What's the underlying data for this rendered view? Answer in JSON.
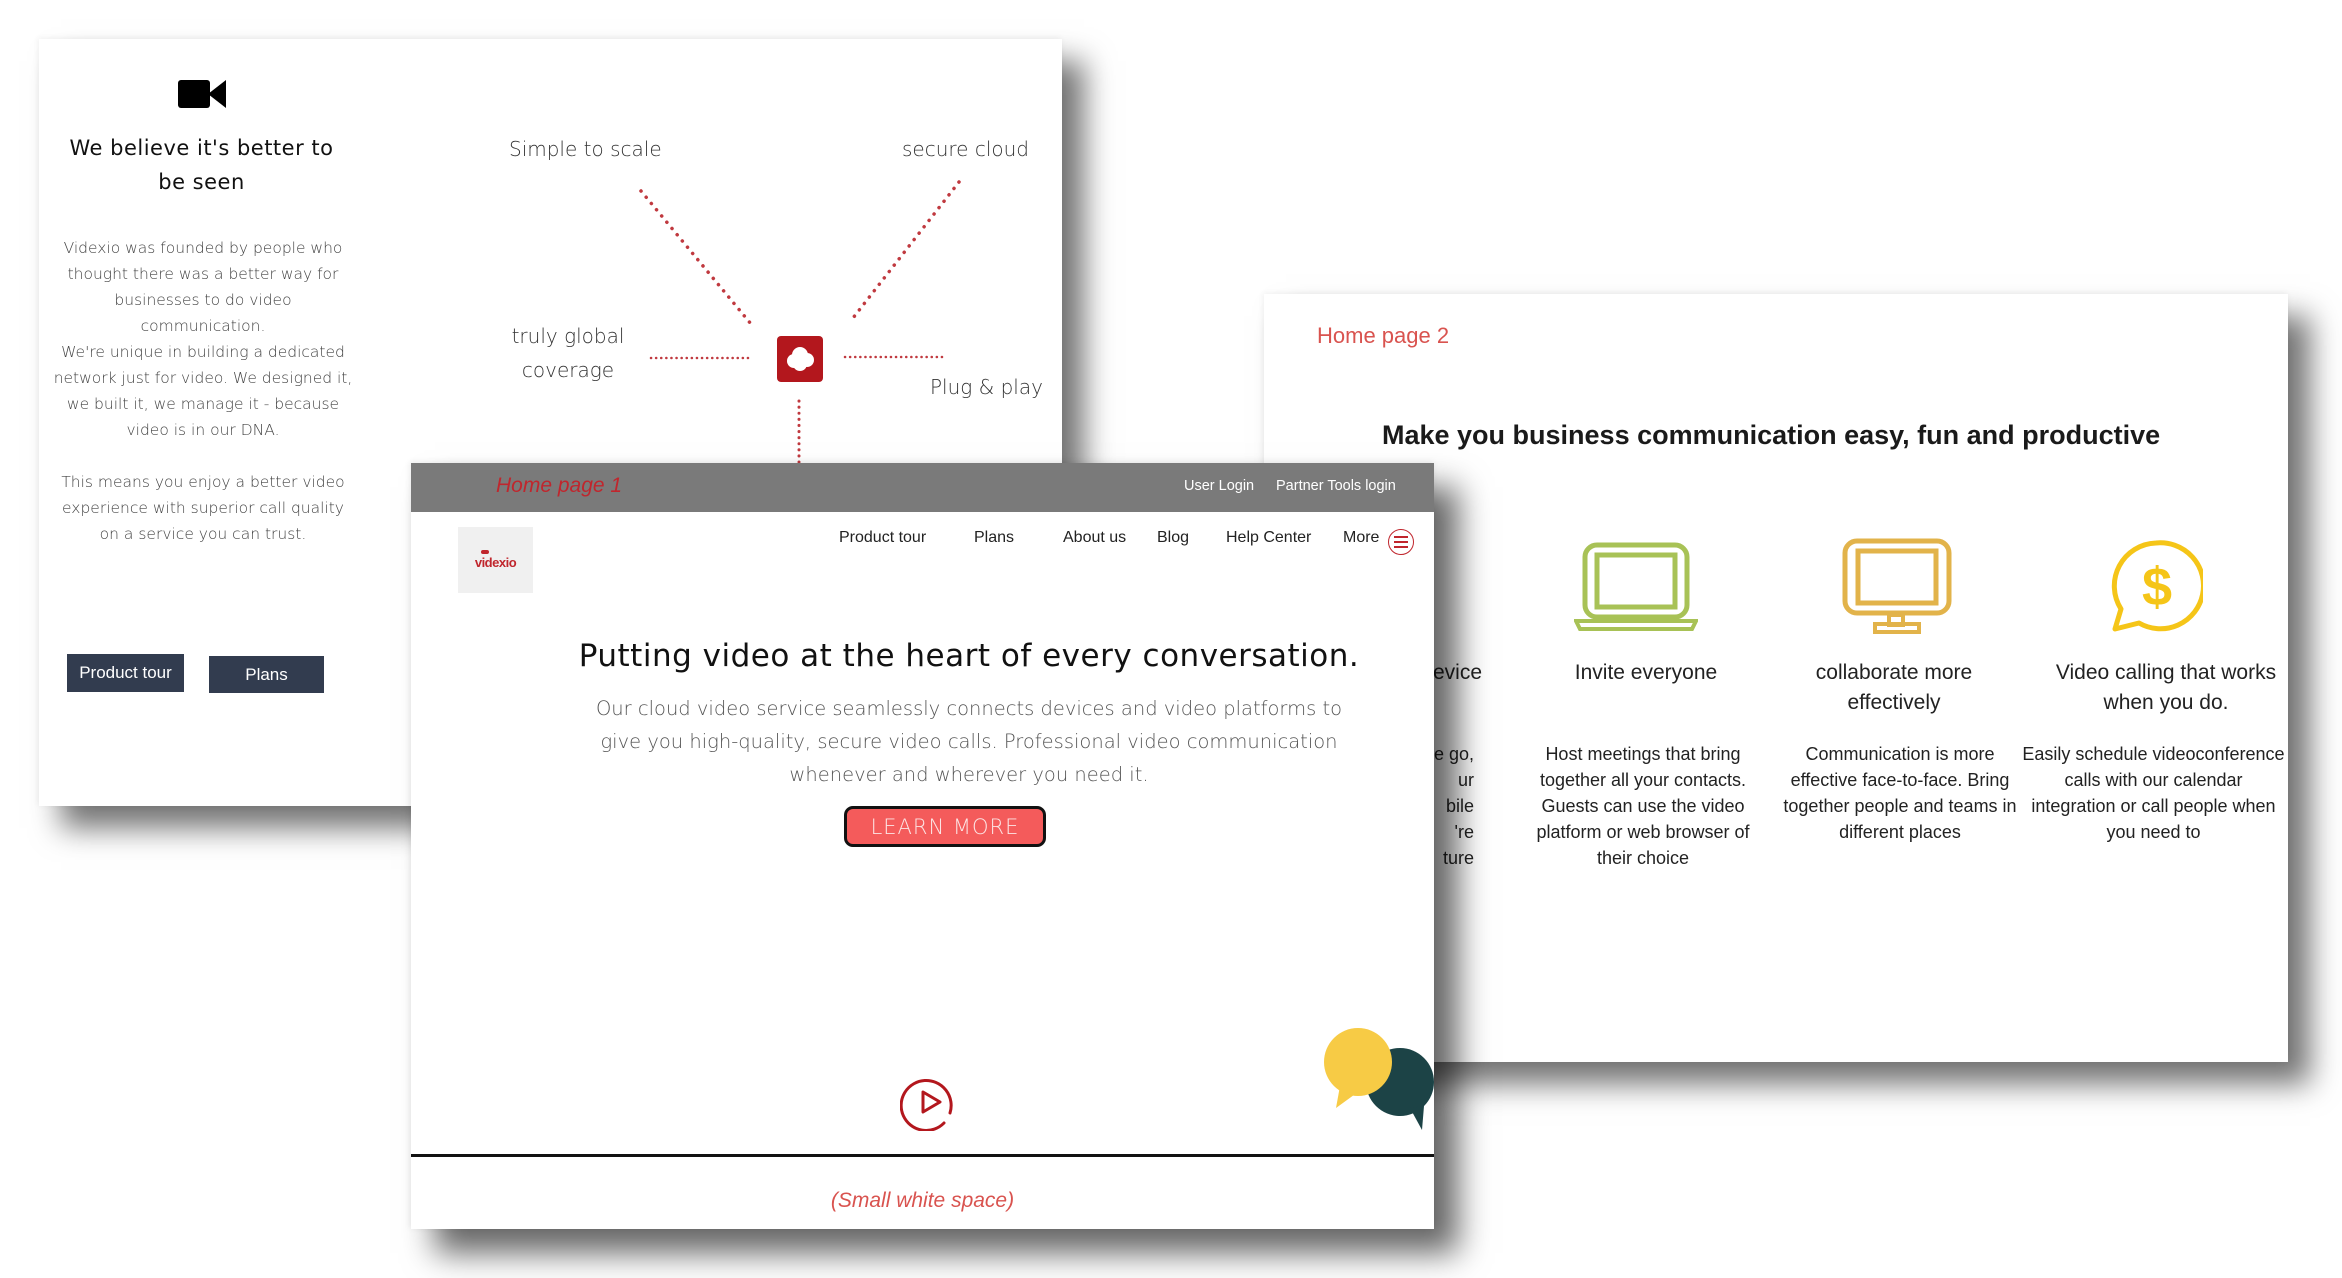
{
  "about_card": {
    "icon": "video-camera-icon",
    "title": "We believe it's better to be seen",
    "paragraphs": [
      "Videxio was founded by people who thought there was a better way for businesses to do video communication.",
      "We're unique in building a dedicated network just for video. We designed it, we built it, we manage it - because video is in our DNA.",
      "This means you enjoy a better video experience with superior call quality on a service you can trust."
    ],
    "buttons": {
      "product_tour": "Product tour",
      "plans": "Plans"
    },
    "diagram": {
      "center_icon": "cloud-icon",
      "labels": {
        "simple": "Simple to scale",
        "secure": "secure cloud",
        "global": "truly global coverage",
        "plug": "Plug & play"
      },
      "accent_color": "#b3171d"
    }
  },
  "home1_card": {
    "label": "Home page 1",
    "top_links": {
      "user_login": "User Login",
      "partner_login": "Partner Tools login"
    },
    "logo_text": "videxio",
    "nav": [
      "Product tour",
      "Plans",
      "About us",
      "Blog",
      "Help Center",
      "More"
    ],
    "menu_icon": "hamburger-menu-icon",
    "hero": {
      "title": "Putting video at the heart of every conversation.",
      "subtitle": "Our cloud video service seamlessly connects devices and video platforms to give you high-quality, secure video calls. Professional video communication whenever and wherever you need it.",
      "cta": "LEARN MORE"
    },
    "play_icon": "play-circle-icon",
    "chat_icon": "chat-bubbles-icon",
    "footer_note": "(Small white space)",
    "colors": {
      "topbar": "#7a7a7a",
      "accent": "#c0262d",
      "cta": "#f45b5b"
    }
  },
  "home2_card": {
    "label": "Home page 2",
    "headline": "Make you business communication easy, fun and productive",
    "features": [
      {
        "title": "evice",
        "desc": "e go,\nur\nbile\n're\nture",
        "icon": ""
      },
      {
        "title": "Invite everyone",
        "desc": "Host meetings that bring together all your contacts. Guests can use the video platform or web browser of their choice",
        "icon": "laptop-icon",
        "color": "#a8c256"
      },
      {
        "title": "collaborate more effectively",
        "desc": "Communication is more effective face-to-face. Bring together people and teams in different places",
        "icon": "monitor-icon",
        "color": "#e2b34a"
      },
      {
        "title": "Video calling that works when you do.",
        "desc": "Easily schedule videoconference calls with our calendar integration or call people when you need to",
        "icon": "dollar-chat-icon",
        "color": "#f5c518"
      }
    ]
  }
}
